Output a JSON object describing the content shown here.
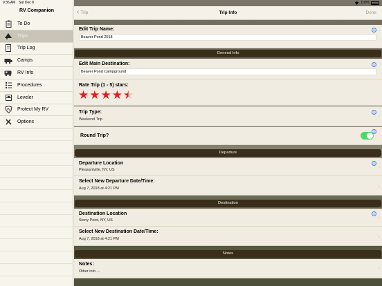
{
  "status": {
    "time": "9:36 AM",
    "date": "Sat Dec 8",
    "battery": "100%"
  },
  "sidebar": {
    "title": "RV Companion",
    "items": [
      {
        "label": "To Do",
        "icon": "clipboard-icon"
      },
      {
        "label": "Trips",
        "icon": "trailer-icon",
        "selected": true
      },
      {
        "label": "Trip Log",
        "icon": "notebook-icon"
      },
      {
        "label": "Camps",
        "icon": "rv-camp-icon"
      },
      {
        "label": "RV Info",
        "icon": "rv-icon"
      },
      {
        "label": "Procedures",
        "icon": "checklist-icon"
      },
      {
        "label": "Leveler",
        "icon": "level-icon"
      },
      {
        "label": "Protect My RV",
        "icon": "shield-icon"
      },
      {
        "label": "Options",
        "icon": "tools-icon"
      }
    ]
  },
  "navbar": {
    "back_label": "Trip",
    "title": "Trip Info",
    "done_label": "Done"
  },
  "form": {
    "trip_name_label": "Edit Trip Name:",
    "trip_name_value": "Beaver Pond 2018",
    "general_section": "General Info",
    "main_dest_label": "Edit Main Destination:",
    "main_dest_value": "Beaver Pond Campground",
    "rate_label": "Rate Trip (1 - 5) stars:",
    "rating": 4.5,
    "trip_type_label": "Trip Type:",
    "trip_type_value": "Weekend Trip",
    "round_trip_label": "Round Trip?",
    "round_trip_on": true,
    "departure_section": "Departure",
    "departure_loc_label": "Departure Location",
    "departure_loc_value": "Pleasantville, NY, US",
    "departure_date_label": "Select New Departure Date/Time:",
    "departure_date_value": "Aug 7, 2018 at 4:21 PM",
    "destination_section": "Destination",
    "destination_loc_label": "Destination Location",
    "destination_loc_value": "Stony Point, NY, US",
    "destination_date_label": "Select New Destination Date/Time:",
    "destination_date_value": "Aug 7, 2018 at 4:21 PM",
    "notes_section": "Notes",
    "notes_label": "Notes:",
    "notes_value": "Other info ..."
  },
  "colors": {
    "accent": "#3b82f6",
    "star": "#e51c1c",
    "toggle": "#4cd964",
    "section_bar": "#3a2e1a"
  }
}
